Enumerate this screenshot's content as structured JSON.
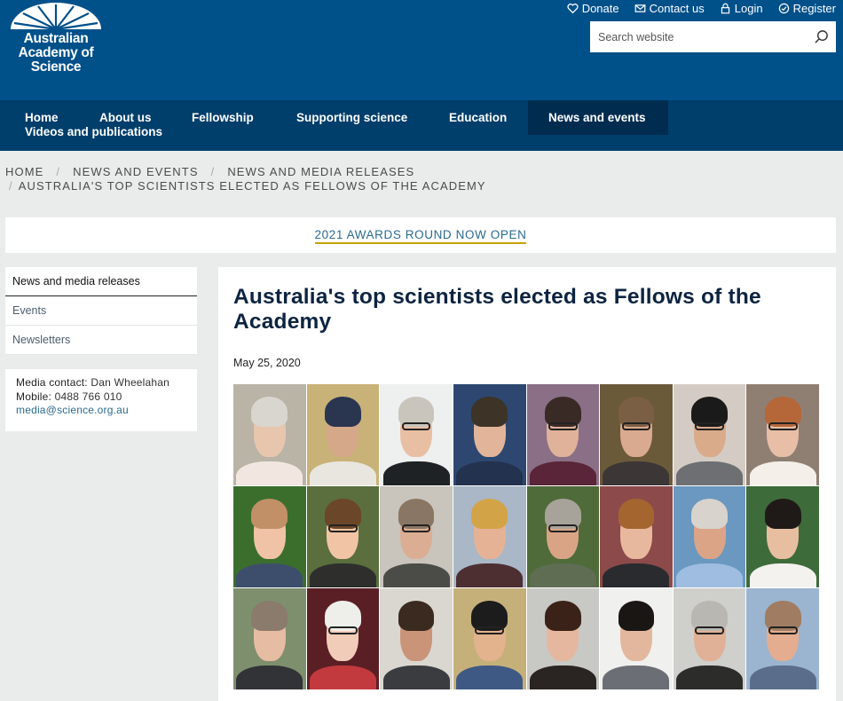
{
  "header": {
    "logo": {
      "line1": "Australian",
      "line2": "Academy of",
      "line3": "Science"
    },
    "utility": [
      {
        "label": "Donate",
        "icon": "heart-icon"
      },
      {
        "label": "Contact us",
        "icon": "mail-icon"
      },
      {
        "label": "Login",
        "icon": "lock-icon"
      },
      {
        "label": "Register",
        "icon": "check-circle-icon"
      }
    ],
    "search": {
      "placeholder": "Search website",
      "icon": "search-icon"
    }
  },
  "nav": {
    "items": [
      "Home",
      "About us",
      "Fellowship",
      "Supporting science",
      "Education",
      "News and events",
      "Videos and publications"
    ],
    "active": "News and events"
  },
  "breadcrumb": {
    "items": [
      "HOME",
      "NEWS AND EVENTS",
      "NEWS AND MEDIA RELEASES"
    ],
    "current": "AUSTRALIA'S TOP SCIENTISTS ELECTED AS FELLOWS OF THE ACADEMY"
  },
  "banner": {
    "label": "2021 AWARDS ROUND NOW OPEN"
  },
  "sidebar": {
    "items": [
      "News and media releases",
      "Events",
      "Newsletters"
    ],
    "active": "News and media releases"
  },
  "contact": {
    "media_label": "Media contact:",
    "media_name": "Dan Wheelahan",
    "mobile_label": "Mobile:",
    "mobile_value": "0488 766 010",
    "email": "media@science.org.au"
  },
  "article": {
    "title": "Australia's top scientists elected as Fellows of the Academy",
    "date": "May 25, 2020"
  },
  "colors": {
    "header": "#00508a",
    "nav": "#003e6b",
    "nav_active": "#002c4f",
    "banner_underline": "#c8a200",
    "link": "#2b6a8f"
  }
}
